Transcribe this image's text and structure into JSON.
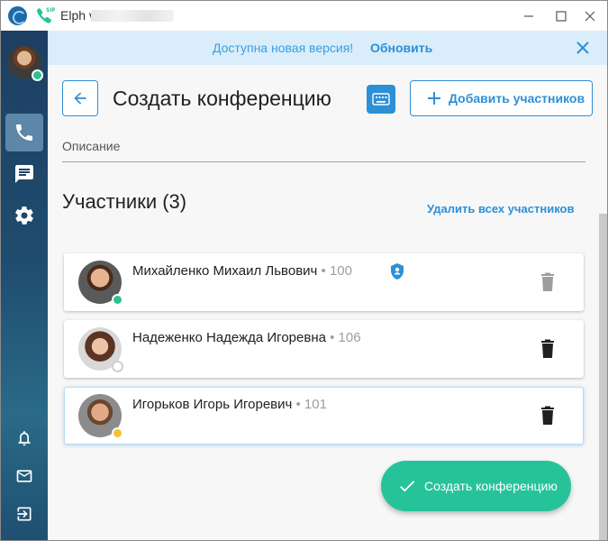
{
  "app": {
    "title": "Elph v",
    "window_controls": [
      "minimize-icon",
      "maximize-icon",
      "close-icon"
    ]
  },
  "sidebar": {
    "user_status": "online",
    "nav": [
      {
        "icon": "phone-icon",
        "active": true
      },
      {
        "icon": "chat-icon",
        "active": false
      },
      {
        "icon": "gear-icon",
        "active": false
      }
    ],
    "bottom": [
      "bell-icon",
      "mail-icon",
      "logout-icon"
    ]
  },
  "update_bar": {
    "message": "Доступна новая версия!",
    "action": "Обновить"
  },
  "header": {
    "title": "Создать конференцию",
    "add_participants": "Добавить участников"
  },
  "description": {
    "label": "Описание"
  },
  "participants": {
    "title": "Участники (3)",
    "remove_all": "Удалить всех участников",
    "items": [
      {
        "name": "Михайленко Михаил Львович",
        "ext": " • 100",
        "status": "online",
        "admin": true
      },
      {
        "name": "Надеженко Надежда Игоревна",
        "ext": " • 106",
        "status": "offline",
        "admin": false
      },
      {
        "name": "Игорьков Игорь Игоревич",
        "ext": " • 101",
        "status": "away",
        "admin": false
      }
    ]
  },
  "actions": {
    "create": "Создать конференцию"
  },
  "colors": {
    "accent": "#2d8fd6",
    "fab": "#26c39a",
    "online": "#2ebf8f",
    "away": "#f2c230"
  }
}
